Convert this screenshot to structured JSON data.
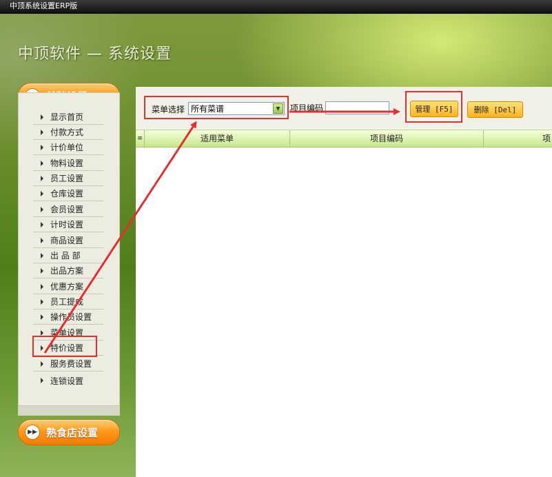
{
  "window": {
    "title": "中顶系统设置ERP版"
  },
  "header": {
    "brand": "中顶软件",
    "dash": "—",
    "module": "系统设置"
  },
  "sidebar": {
    "section_basic": {
      "label": "基础设置",
      "icon": "double-arrow-icon"
    },
    "items": [
      {
        "label": "显示首页"
      },
      {
        "label": "付款方式"
      },
      {
        "label": "计价单位"
      },
      {
        "label": "物料设置"
      },
      {
        "label": "员工设置"
      },
      {
        "label": "仓库设置"
      },
      {
        "label": "会员设置"
      },
      {
        "label": "计时设置"
      },
      {
        "label": "商品设置"
      },
      {
        "label": "出 品 部"
      },
      {
        "label": "出品方案"
      },
      {
        "label": "优惠方案"
      },
      {
        "label": "员工提成"
      },
      {
        "label": "操作员设置"
      },
      {
        "label": "菜单设置"
      },
      {
        "label": "特价设置"
      },
      {
        "label": "服务费设置"
      },
      {
        "label": "连锁设置"
      }
    ],
    "section_deli": {
      "label": "熟食店设置",
      "icon": "double-arrow-icon"
    }
  },
  "toolbar": {
    "menu_select_label": "菜单选择",
    "menu_select_value": "所有菜谱",
    "item_code_label": "项目编码",
    "item_code_value": "",
    "manage_button": "管理 [F5]",
    "delete_button": "删除 [Del]"
  },
  "grid": {
    "columns": [
      "适用菜单",
      "项目编码",
      "项"
    ]
  },
  "colors": {
    "annotation_red": "#e03030",
    "nav_orange": "#ff9a1a",
    "grid_header_green": "#c6e68a"
  }
}
